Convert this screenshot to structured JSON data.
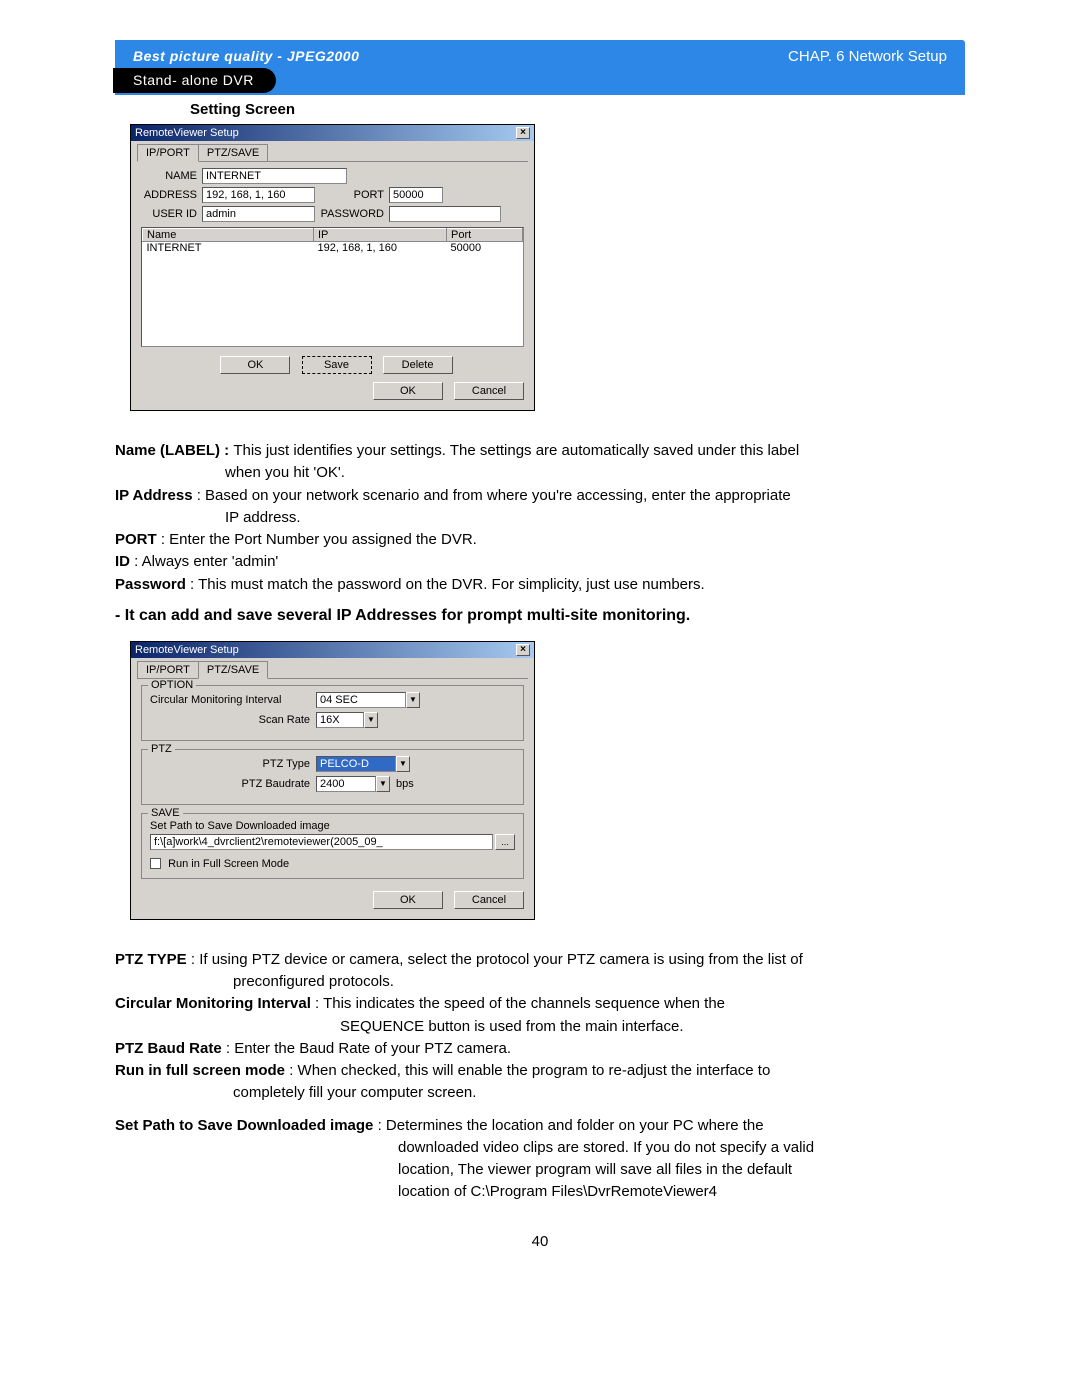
{
  "header": {
    "quality": "Best picture quality - JPEG2000",
    "subtitle": "Stand- alone DVR",
    "chapter": "CHAP.  6  Network Setup"
  },
  "section_title": "Setting Screen",
  "dialog1": {
    "title": "RemoteViewer Setup",
    "close": "×",
    "tabs": {
      "ipport": "IP/PORT",
      "ptzsave": "PTZ/SAVE"
    },
    "labels": {
      "name": "NAME",
      "address": "ADDRESS",
      "port": "PORT",
      "userid": "USER ID",
      "password": "PASSWORD"
    },
    "values": {
      "name": "INTERNET",
      "address": "192, 168, 1, 160",
      "port": "50000",
      "userid": "admin",
      "password": ""
    },
    "list": {
      "cols": {
        "name": "Name",
        "ip": "IP",
        "port": "Port"
      },
      "rows": [
        {
          "name": "INTERNET",
          "ip": "192, 168, 1, 160",
          "port": "50000"
        }
      ]
    },
    "buttons": {
      "ok": "OK",
      "save": "Save",
      "delete": "Delete",
      "cancel": "Cancel"
    }
  },
  "descriptions1": {
    "name_bold": "Name (LABEL) : ",
    "name_text": "This just identifies your settings. The settings are automatically saved under this label",
    "name_cont": "when you hit 'OK'.",
    "ip_bold": "IP Address",
    "ip_text": " : Based on your network scenario and from where you're accessing, enter the appropriate",
    "ip_cont": "IP address.",
    "port_bold": "PORT",
    "port_text": " : Enter the Port Number you assigned the DVR.",
    "id_bold": "ID",
    "id_text": " : Always enter 'admin'",
    "pw_bold": "Password",
    "pw_text": " : This must match the password on the DVR. For simplicity, just use numbers."
  },
  "bold_line": "- It can add and save several IP Addresses for prompt multi-site monitoring.",
  "dialog2": {
    "title": "RemoteViewer Setup",
    "close": "×",
    "tabs": {
      "ipport": "IP/PORT",
      "ptzsave": "PTZ/SAVE"
    },
    "option_legend": "OPTION",
    "circular_label": "Circular Monitoring Interval",
    "circular_value": "04 SEC",
    "scan_label": "Scan Rate",
    "scan_value": "16X",
    "ptz_legend": "PTZ",
    "ptz_type_label": "PTZ Type",
    "ptz_type_value": "PELCO-D",
    "ptz_baud_label": "PTZ Baudrate",
    "ptz_baud_value": "2400",
    "bps": "bps",
    "save_legend": "SAVE",
    "save_path_label": "Set Path to Save Downloaded image",
    "save_path_value": "f:\\[a]work\\4_dvrclient2\\remoteviewer(2005_09_",
    "browse": "...",
    "fullscreen_label": "Run in Full Screen Mode",
    "buttons": {
      "ok": "OK",
      "cancel": "Cancel"
    }
  },
  "descriptions2": {
    "ptztype_bold": "PTZ TYPE",
    "ptztype_text": " : If using PTZ device or camera, select the protocol your PTZ camera is using from the list of",
    "ptztype_cont": "preconfigured protocols.",
    "circ_bold": "Circular Monitoring Interval",
    "circ_text": " : This indicates the speed of  the channels sequence when the",
    "circ_cont": "SEQUENCE button is used from the main interface.",
    "baud_bold": "PTZ Baud Rate",
    "baud_text": " : Enter the Baud Rate of your PTZ camera.",
    "full_bold": "Run in full screen mode",
    "full_text": " : When checked, this will enable the program to re-adjust the interface to",
    "full_cont": "completely fill your computer screen.",
    "path_bold": "Set Path to Save Downloaded image",
    "path_text": " : Determines the location and folder on your PC where the",
    "path_cont1": "downloaded video clips are stored. If you do not specify a valid",
    "path_cont2": "location, The viewer program will save all files in the default",
    "path_cont3": "location of C:\\Program Files\\DvrRemoteViewer4"
  },
  "page_number": "40"
}
